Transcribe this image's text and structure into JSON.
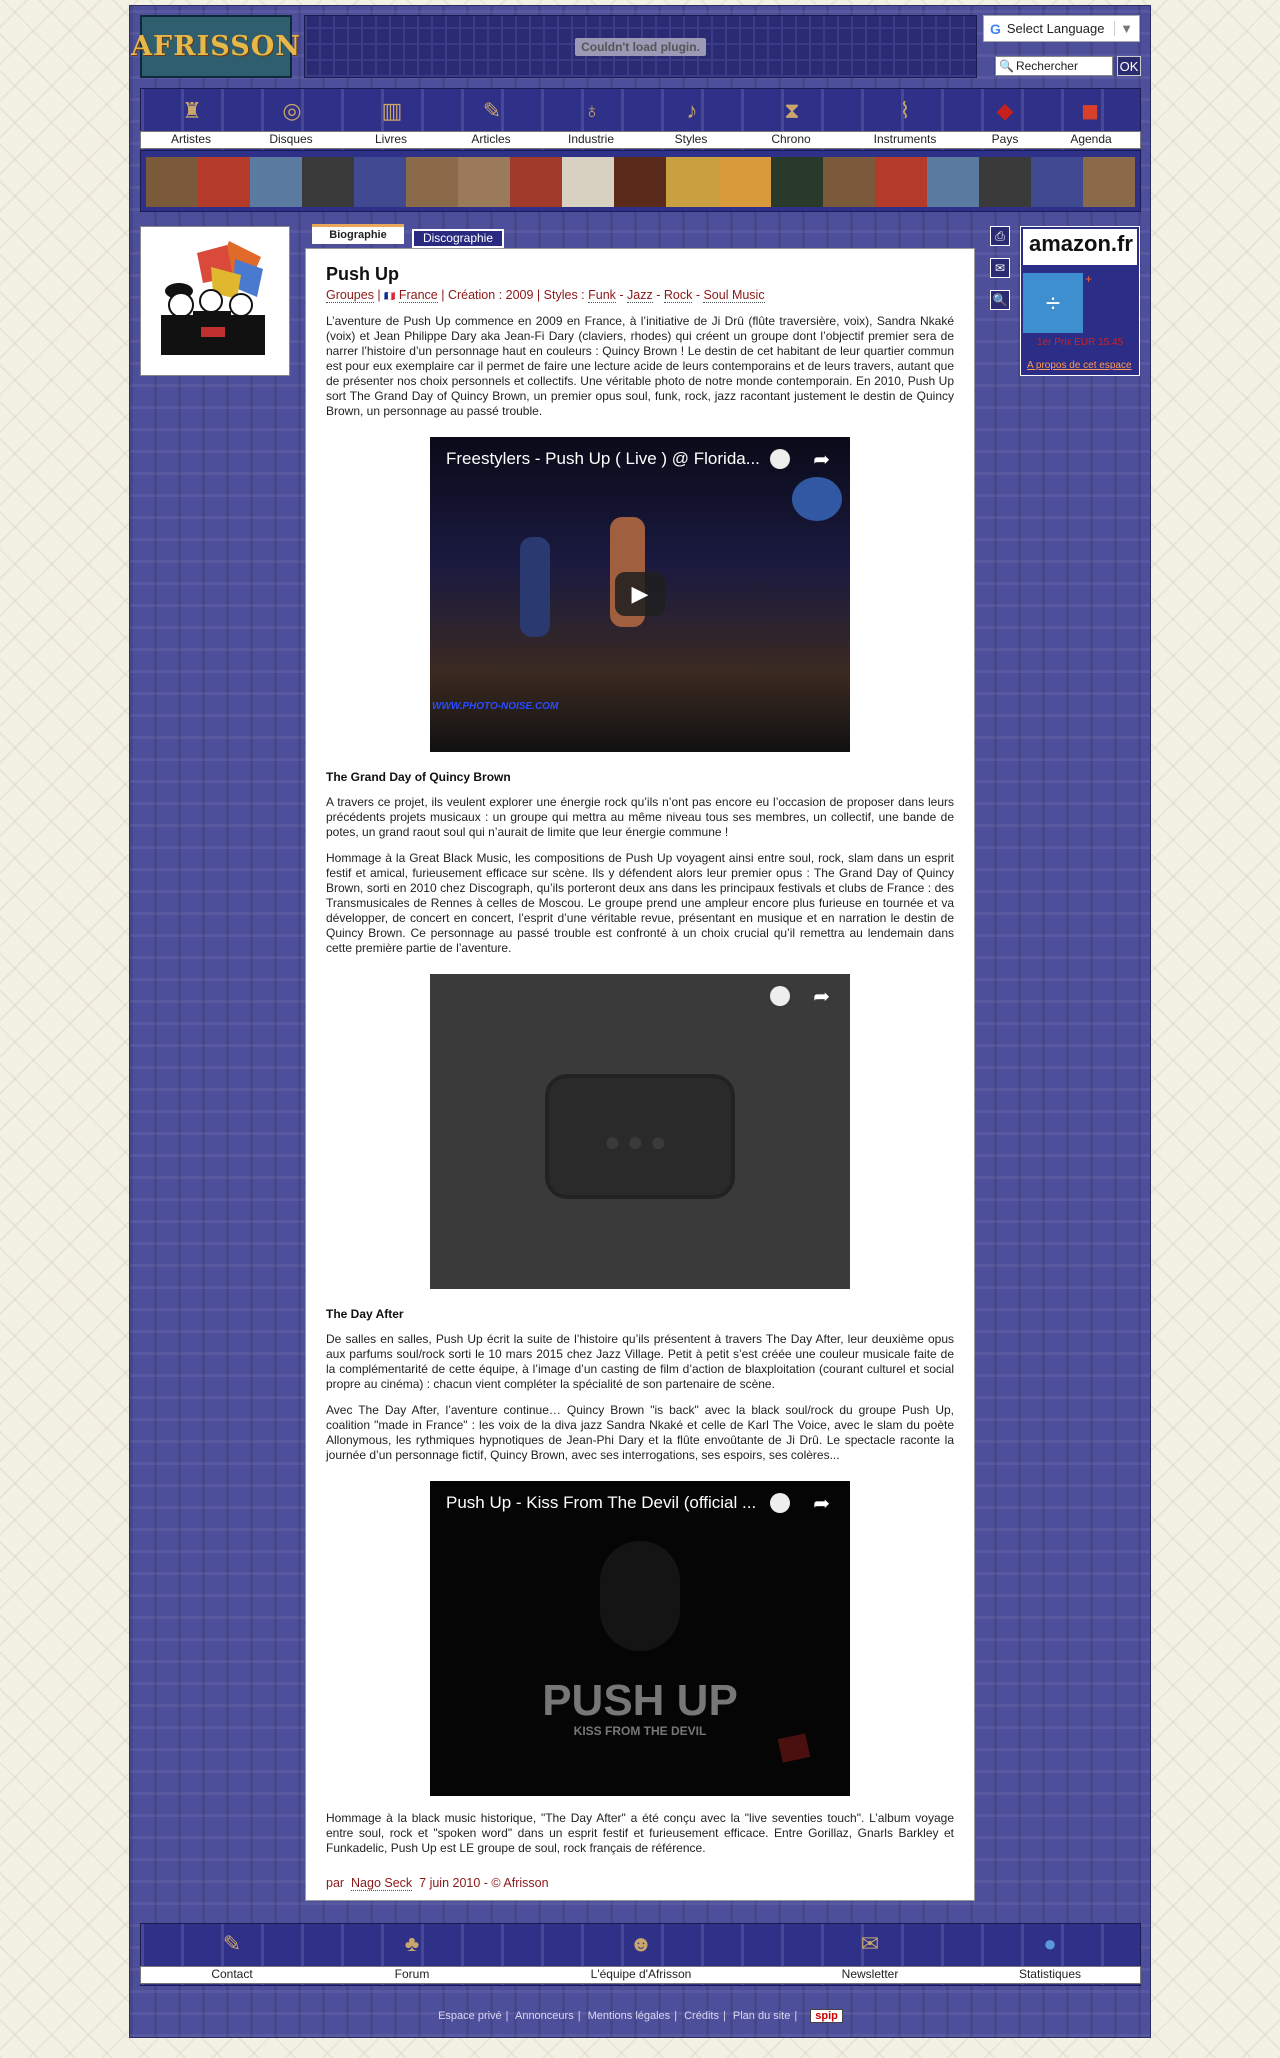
{
  "header": {
    "logo_text": "AFRISSON",
    "plugin_message": "Couldn't load plugin.",
    "language_select": "Select Language",
    "search_placeholder": "Rechercher",
    "search_button": "OK"
  },
  "nav": {
    "items": [
      {
        "label": "Artistes",
        "icon": "artist-icon"
      },
      {
        "label": "Disques",
        "icon": "disc-icon"
      },
      {
        "label": "Livres",
        "icon": "book-icon"
      },
      {
        "label": "Articles",
        "icon": "pen-icon"
      },
      {
        "label": "Industrie",
        "icon": "guitar-icon"
      },
      {
        "label": "Styles",
        "icon": "music-note-icon"
      },
      {
        "label": "Chrono",
        "icon": "hourglass-icon"
      },
      {
        "label": "Instruments",
        "icon": "flute-icon"
      },
      {
        "label": "Pays",
        "icon": "africa-map-icon"
      },
      {
        "label": "Agenda",
        "icon": "calendar-icon"
      }
    ]
  },
  "tabs": {
    "biography": "Biographie",
    "discography": "Discographie"
  },
  "article": {
    "title": "Push Up",
    "meta": {
      "groups": "Groupes",
      "country": "France",
      "creation": "Création : 2009",
      "styles_label": "Styles :",
      "styles": [
        "Funk",
        "Jazz",
        "Rock",
        "Soul Music"
      ]
    },
    "p1": "L’aventure de Push Up commence en 2009 en France, à l’initiative de Ji Drû (flûte traversière, voix), Sandra Nkaké (voix) et Jean Philippe Dary aka Jean-Fi Dary (claviers, rhodes) qui créent un groupe dont l’objectif premier sera de narrer l’histoire d’un personnage haut en couleurs : Quincy Brown ! Le destin de cet habitant de leur quartier commun est pour eux exemplaire car il permet de faire une lecture acide de leurs contemporains et de leurs travers, autant que de présenter nos choix personnels et collectifs. Une véritable photo de notre monde contemporain. En 2010, Push Up sort The Grand Day of Quincy Brown, un premier opus soul, funk, rock, jazz racontant justement le destin de Quincy Brown, un personnage au passé trouble.",
    "video1_title": "Freestylers - Push Up ( Live ) @ Florida...",
    "video1_watermark": "WWW.PHOTO-NOISE.COM",
    "sub1": "The Grand Day of Quincy Brown",
    "p2": "A travers ce projet, ils veulent explorer une énergie rock qu’ils n’ont pas encore eu l’occasion de proposer dans leurs précédents projets musicaux : un groupe qui mettra au même niveau tous ses membres, un collectif, une bande de potes, un grand raout soul qui n’aurait de limite que leur énergie commune !",
    "p3": "Hommage à la Great Black Music, les compositions de Push Up voyagent ainsi entre soul, rock, slam dans un esprit festif et amical, furieusement efficace sur scène. Ils y défendent alors leur premier opus : The Grand Day of Quincy Brown, sorti en 2010 chez Discograph, qu’ils porteront deux ans dans les principaux festivals et clubs de France : des Transmusicales de Rennes à celles de Moscou. Le groupe prend une ampleur encore plus furieuse en tournée et va développer, de concert en concert, l’esprit d’une véritable revue, présentant en musique et en narration le destin de Quincy Brown. Ce personnage au passé trouble est confronté à un choix crucial qu’il remettra au lendemain dans cette première partie de l’aventure.",
    "sub2": "The Day After",
    "p4": "De salles en salles, Push Up écrit la suite de l’histoire qu’ils présentent à travers The Day After, leur deuxième opus aux parfums soul/rock sorti le 10 mars 2015 chez Jazz Village. Petit à petit s’est créée une couleur musicale faite de la complémentarité de cette équipe, à l’image d’un casting de film d’action de blaxploitation (courant culturel et social propre au cinéma) : chacun vient compléter la spécialité de son partenaire de scène.",
    "p5": "Avec The Day After, l’aventure continue… Quincy Brown \"is back\" avec la black soul/rock du groupe Push Up, coalition \"made in France\" : les voix de la diva jazz Sandra Nkaké et celle de Karl The Voice, avec le slam du poète Allonymous, les rythmiques hypnotiques de Jean-Phi Dary et la flûte envoûtante de Ji Drû. Le spectacle raconte la journée d’un personnage fictif, Quincy Brown, avec ses interrogations, ses espoirs, ses colères...",
    "video3_title": "Push Up - Kiss From The Devil (official ...",
    "video3_logo": "PUSH UP",
    "video3_sublogo": "KISS FROM THE DEVIL",
    "p6": "Hommage à la black music historique, \"The Day After\" a été conçu avec la \"live seventies touch\". L’album voyage entre soul, rock et \"spoken word\" dans un esprit festif et furieusement efficace. Entre Gorillaz, Gnarls Barkley et Funkadelic, Push Up est LE groupe de soul, rock français de référence.",
    "author_prefix": "par",
    "author": "Nago Seck",
    "date": "7 juin 2010 - © Afrisson"
  },
  "sidebar": {
    "amazon_logo": "amazon.fr",
    "amazon_plus": "+",
    "amazon_price": "1er Prix EUR 15.45",
    "amazon_about": "A propos de cet espace"
  },
  "bottom_nav": {
    "items": [
      {
        "label": "Contact",
        "icon": "contact-icon"
      },
      {
        "label": "Forum",
        "icon": "tree-icon"
      },
      {
        "label": "L'équipe d'Afrisson",
        "icon": "mask-icon"
      },
      {
        "label": "Newsletter",
        "icon": "letter-icon"
      },
      {
        "label": "Statistiques",
        "icon": "globe-icon"
      }
    ]
  },
  "footer": {
    "links": [
      "Espace privé",
      "Annonceurs",
      "Mentions légales",
      "Crédits",
      "Plan du site"
    ],
    "badge": "spip"
  }
}
